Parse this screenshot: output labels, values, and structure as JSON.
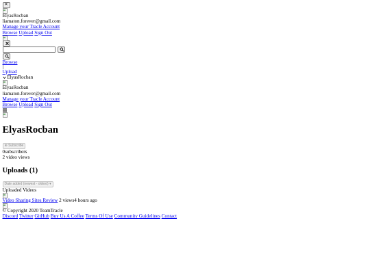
{
  "top": {
    "close_glyph": "✕",
    "username": "ElyasRocban",
    "email": "liamaton.forever@gmail.com",
    "manage_link": "Manage your Tracle Account",
    "links": [
      "Browse",
      "Upload",
      "Sign Out"
    ]
  },
  "search": {
    "placeholder": "",
    "value": ""
  },
  "nav": {
    "browse": "Browse",
    "upload": "Upload",
    "user": "ElyasRocban"
  },
  "dropdown": {
    "username": "ElyasRocban",
    "email": "liamaton.forever@gmail.com",
    "manage_link": "Manage your Tracle Account",
    "links": [
      "Browse",
      "Upload",
      "Sign Out"
    ]
  },
  "channel": {
    "name": "ElyasRocban",
    "subscribe_label": "Subscribe",
    "subscribers_count": "0",
    "subscribers_label": "subscribers",
    "video_views": "2 video views"
  },
  "uploads": {
    "heading": "Uploads (1)",
    "sort_label": "Date added (newest - oldest)",
    "section_label": "Uploaded Videos",
    "videos": [
      {
        "title": "Video Sharing Sites Review",
        "views": "2 views",
        "age": "4 hours ago"
      }
    ]
  },
  "footer": {
    "copyright": "© Copyright 2020 TeamTracle",
    "links": [
      "Discord",
      "Twitter",
      "GitHub",
      "Buy Us A Coffee",
      "Terms Of Use",
      "Community Guidelines",
      "Contact"
    ]
  },
  "colors": {
    "link": "#0000ee",
    "button_bg": "#efefef",
    "button_border": "#767676"
  }
}
